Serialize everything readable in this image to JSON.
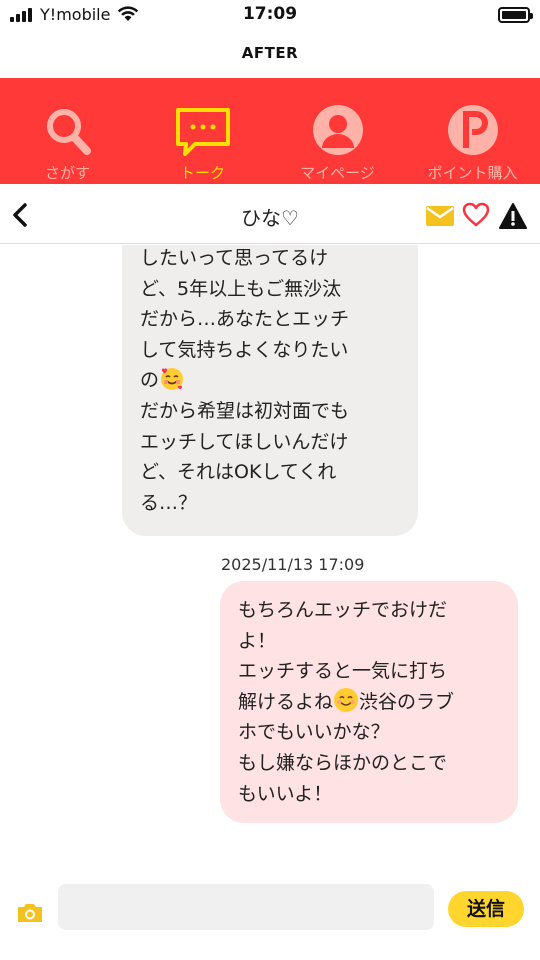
{
  "status_bar": {
    "carrier": "Y!mobile",
    "time": "17:09"
  },
  "header_caption": "AFTER",
  "tabs": [
    {
      "label": "さがす",
      "icon": "search-icon",
      "active": false
    },
    {
      "label": "トーク",
      "icon": "chat-bubble-icon",
      "active": true
    },
    {
      "label": "マイページ",
      "icon": "user-icon",
      "active": false
    },
    {
      "label": "ポイント購入",
      "icon": "points-icon",
      "active": false
    }
  ],
  "chat_header": {
    "title": "ひな♡"
  },
  "messages": {
    "received": {
      "lines": [
        "したいって思ってるけ",
        "ど、5年以上もご無沙汰",
        "だから…あなたとエッチ",
        "して気持ちよくなりたい",
        "の"
      ],
      "lines2": "だから希望は初対面でも\nエッチしてほしいんだけ\nど、それはOKしてくれ\nる…？"
    },
    "sent_timestamp": "2025/11/13 17:09",
    "sent": {
      "part1": "もちろんエッチでおけだ\nよ！\nエッチすると一気に打ち\n解けるよね",
      "part2": "渋谷のラブ\nホでもいいかな？\nもし嫌ならほかのとこで\nもいいよ！"
    }
  },
  "composer": {
    "placeholder": "",
    "send_label": "送信"
  },
  "colors": {
    "tab_bar": "#ff3838",
    "active_tab": "#ffe000",
    "send_button": "#ffd52e",
    "received_bubble": "#efeeec",
    "sent_bubble": "#ffe2e3"
  }
}
